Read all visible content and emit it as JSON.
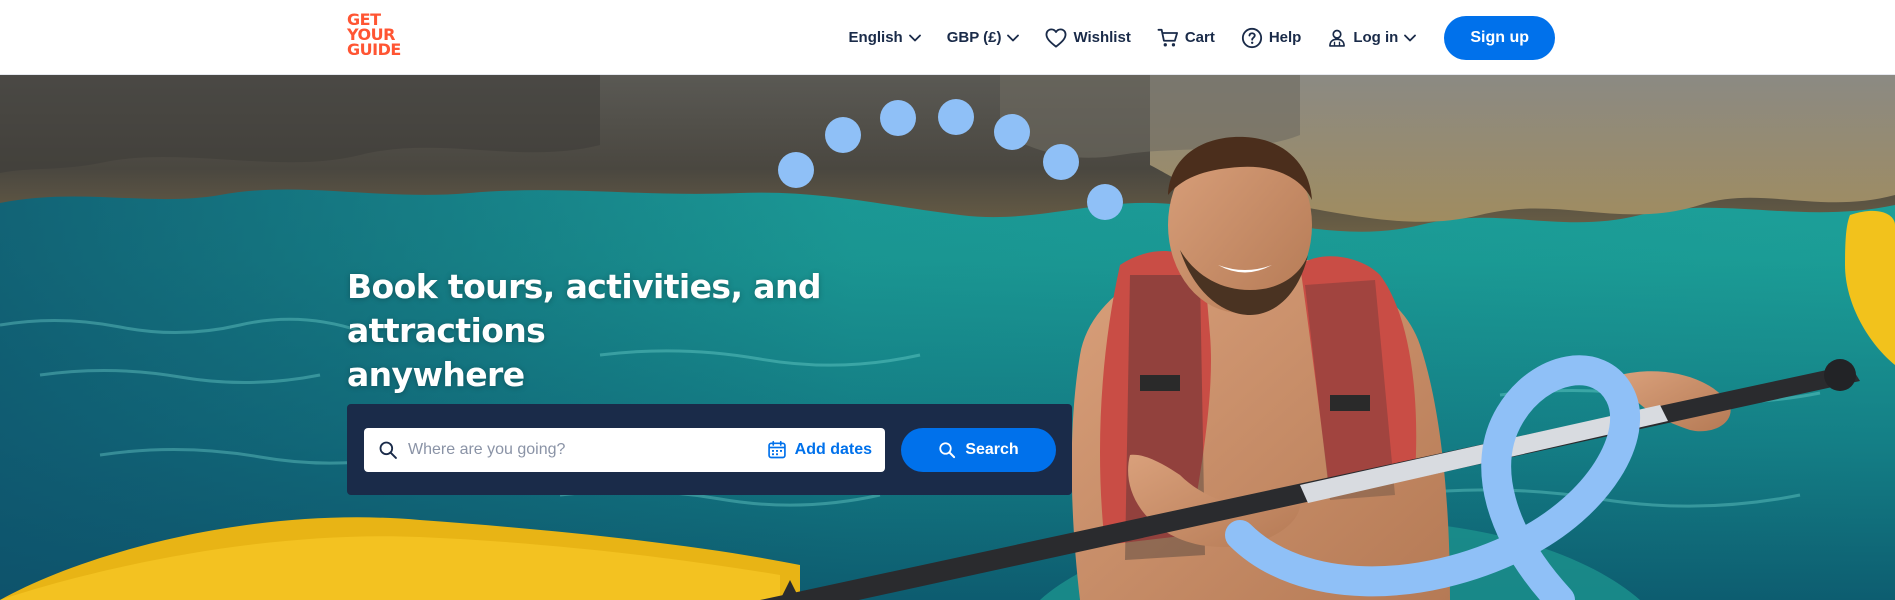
{
  "brand": {
    "logo_lines": [
      "GET",
      "YOUR",
      "GUIDE"
    ],
    "logo_color": "#ff5533",
    "accent_color": "#0071eb",
    "navy_color": "#1a2b49"
  },
  "nav": {
    "language": {
      "label": "English",
      "icon": "chevron-down-icon"
    },
    "currency": {
      "label": "GBP (£)",
      "icon": "chevron-down-icon"
    },
    "wishlist": {
      "label": "Wishlist",
      "icon": "heart-icon"
    },
    "cart": {
      "label": "Cart",
      "icon": "cart-icon"
    },
    "help": {
      "label": "Help",
      "icon": "help-icon"
    },
    "login": {
      "label": "Log in",
      "icon": "user-icon"
    },
    "signup": {
      "label": "Sign up"
    }
  },
  "hero": {
    "title_line1": "Book tours, activities, and attractions",
    "title_line2": "anywhere",
    "image": "kayaker-in-turquoise-sea"
  },
  "search": {
    "placeholder": "Where are you going?",
    "value": "",
    "dates_label": "Add dates",
    "button_label": "Search"
  }
}
